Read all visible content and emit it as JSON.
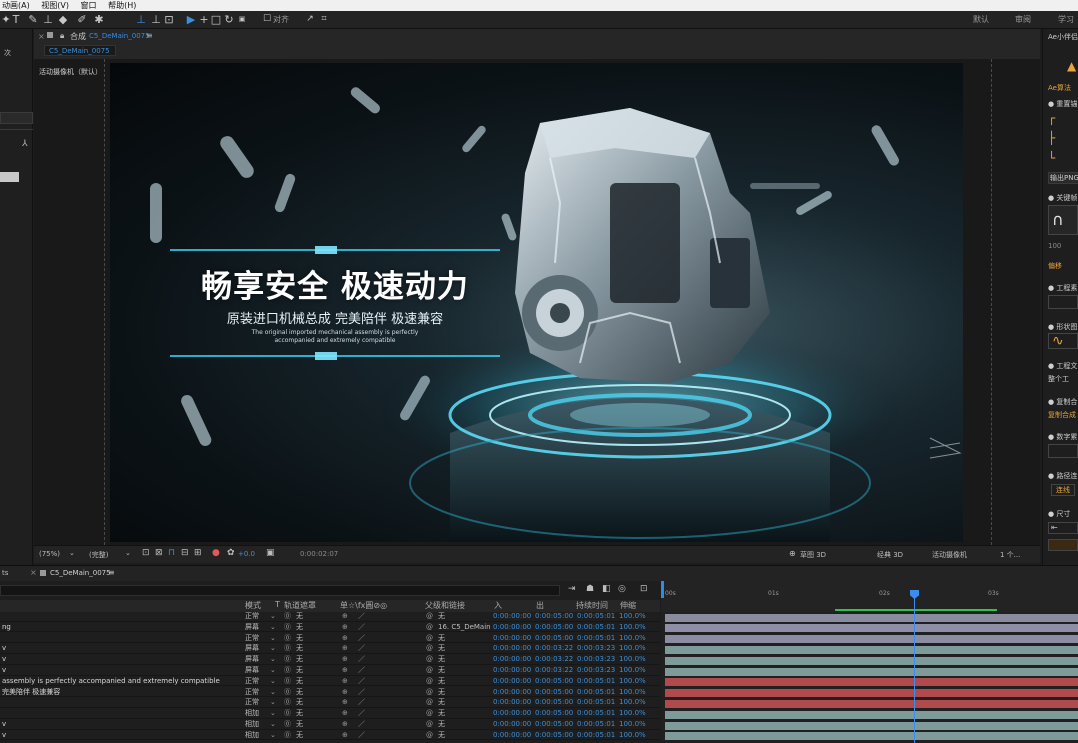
{
  "menubar": {
    "items": [
      "动画(A)",
      "视图(V)",
      "窗口",
      "帮助(H)"
    ]
  },
  "toolbar": {
    "snap_label": "对齐",
    "workspaces": [
      "默认",
      "审阅",
      "学习"
    ]
  },
  "left_panel": {
    "tab_fragment": "次"
  },
  "comp_panel": {
    "tab_prefix": "合成",
    "tab_name": "C5_DeMain_0075",
    "subtab": "C5_DeMain_0075",
    "camera_label": "活动摄像机（默认）"
  },
  "canvas": {
    "headline": "畅享安全 极速动力",
    "subheadline": "原装进口机械总成 完美陪伴 极速兼容",
    "english_line1": "The original imported mechanical assembly is perfectly",
    "english_line2": "accompanied and extremely compatible"
  },
  "comp_footer": {
    "zoom": "(75%)",
    "resolution": "(完整)",
    "exposure": "+0.0",
    "timecode": "0:00:02:07",
    "draft3d": "草图 3D",
    "renderer": "经典 3D",
    "camera": "活动摄像机",
    "views": "1 个..."
  },
  "right_panel": {
    "title": "Ae小伴侣",
    "labels": [
      "Ae算法",
      "● 重置锚",
      "输出PNG",
      "● 关键帧",
      "100",
      "偏移",
      "● 工程素",
      "● 形状图",
      "● 工程文",
      "整个工",
      "● 复制合",
      "复制合成",
      "● 数字累",
      "● 路径连",
      "连线",
      "● 尺寸"
    ]
  },
  "timeline": {
    "tab_label": "C5_DeMain_0075",
    "left_tab_fragment": "ts",
    "columns": [
      "模式",
      "T",
      "轨道遮罩",
      "单☆\\fx圓⊘◎",
      "父级和链接",
      "入",
      "出",
      "持续时间",
      "伸缩"
    ],
    "ruler_marks": [
      "00s",
      "01s",
      "02s",
      "03s"
    ],
    "layers": [
      {
        "name": "",
        "mode": "正常",
        "matte": "无",
        "parent": "无",
        "in": "0:00:00:00",
        "out": "0:00:05:00",
        "dur": "0:00:05:01",
        "stretch": "100.0%",
        "color": "#8b8ba0"
      },
      {
        "name": "ng",
        "mode": "屏幕",
        "matte": "无",
        "parent": "16. C5_DeMain",
        "in": "0:00:00:00",
        "out": "0:00:05:00",
        "dur": "0:00:05:01",
        "stretch": "100.0%",
        "color": "#8e8ea6"
      },
      {
        "name": "",
        "mode": "正常",
        "matte": "无",
        "parent": "无",
        "in": "0:00:00:00",
        "out": "0:00:05:00",
        "dur": "0:00:05:01",
        "stretch": "100.0%",
        "color": "#8c8ca2"
      },
      {
        "name": "v",
        "mode": "屏幕",
        "matte": "无",
        "parent": "无",
        "in": "0:00:00:00",
        "out": "0:00:03:22",
        "dur": "0:00:03:23",
        "stretch": "100.0%",
        "color": "#7e9b99"
      },
      {
        "name": "v",
        "mode": "屏幕",
        "matte": "无",
        "parent": "无",
        "in": "0:00:00:00",
        "out": "0:00:03:22",
        "dur": "0:00:03:23",
        "stretch": "100.0%",
        "color": "#7e9b99"
      },
      {
        "name": "v",
        "mode": "屏幕",
        "matte": "无",
        "parent": "无",
        "in": "0:00:00:00",
        "out": "0:00:03:22",
        "dur": "0:00:03:23",
        "stretch": "100.0%",
        "color": "#7e9b99"
      },
      {
        "name": "assembly is perfectly  accompanied and extremely compatible",
        "mode": "正常",
        "matte": "无",
        "parent": "无",
        "in": "0:00:00:00",
        "out": "0:00:05:00",
        "dur": "0:00:05:01",
        "stretch": "100.0%",
        "color": "#b04a4d"
      },
      {
        "name": "完美陪伴 极速兼容",
        "mode": "正常",
        "matte": "无",
        "parent": "无",
        "in": "0:00:00:00",
        "out": "0:00:05:00",
        "dur": "0:00:05:01",
        "stretch": "100.0%",
        "color": "#b04a4d"
      },
      {
        "name": "",
        "mode": "正常",
        "matte": "无",
        "parent": "无",
        "in": "0:00:00:00",
        "out": "0:00:05:00",
        "dur": "0:00:05:01",
        "stretch": "100.0%",
        "color": "#b04a4d"
      },
      {
        "name": "",
        "mode": "相加",
        "matte": "无",
        "parent": "无",
        "in": "0:00:00:00",
        "out": "0:00:05:00",
        "dur": "0:00:05:01",
        "stretch": "100.0%",
        "color": "#7e9b99"
      },
      {
        "name": "v",
        "mode": "相加",
        "matte": "无",
        "parent": "无",
        "in": "0:00:00:00",
        "out": "0:00:05:00",
        "dur": "0:00:05:01",
        "stretch": "100.0%",
        "color": "#7e9b99"
      },
      {
        "name": "v",
        "mode": "相加",
        "matte": "无",
        "parent": "无",
        "in": "0:00:00:00",
        "out": "0:00:05:00",
        "dur": "0:00:05:01",
        "stretch": "100.0%",
        "color": "#7e9b99"
      }
    ]
  },
  "colors": {
    "accent": "#2d8ceb",
    "playhead": "#3a8cf0",
    "work_area": "#36c24a"
  }
}
